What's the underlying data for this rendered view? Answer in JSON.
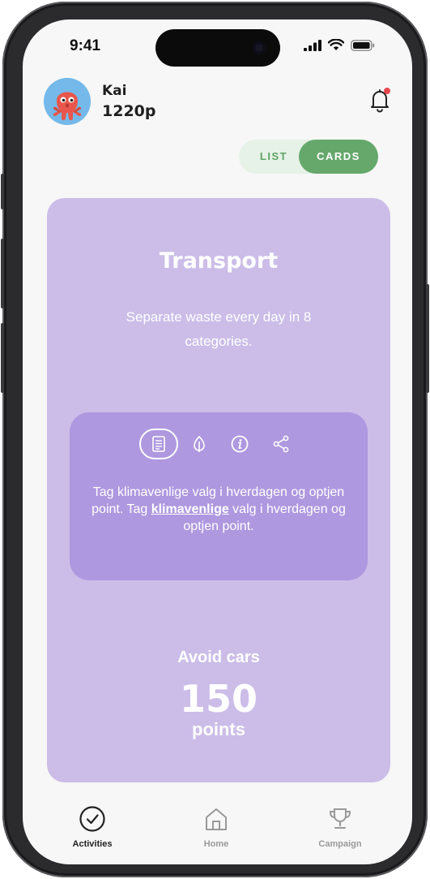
{
  "status_bar": {
    "time": "9:41"
  },
  "user": {
    "name": "Kai",
    "points": "1220p"
  },
  "view_toggle": {
    "list_label": "LIST",
    "cards_label": "CARDS",
    "selected": "CARDS"
  },
  "card": {
    "title": "Transport",
    "subtitle": "Separate waste every day in 8 categories.",
    "info_text_before": "Tag klimavenlige valg i hverdagen og optjen point. Tag ",
    "info_text_link": "klimavenlige",
    "info_text_after": " valg i hverdagen og optjen point.",
    "icons": [
      "document-icon",
      "leaf-icon",
      "info-icon",
      "share-icon"
    ],
    "activity_name": "Avoid cars",
    "activity_points": "150",
    "points_unit": "points"
  },
  "tabbar": {
    "items": [
      {
        "label": "Activities",
        "icon": "check-circle-icon",
        "active": true
      },
      {
        "label": "Home",
        "icon": "home-icon",
        "active": false
      },
      {
        "label": "Campaign",
        "icon": "trophy-icon",
        "active": false
      }
    ]
  },
  "colors": {
    "card_bg": "#cbbde8",
    "inner_bg": "#ae98df",
    "toggle_active": "#66a86c",
    "toggle_bg": "#e6f2e7",
    "notification_dot": "#e5484d"
  }
}
